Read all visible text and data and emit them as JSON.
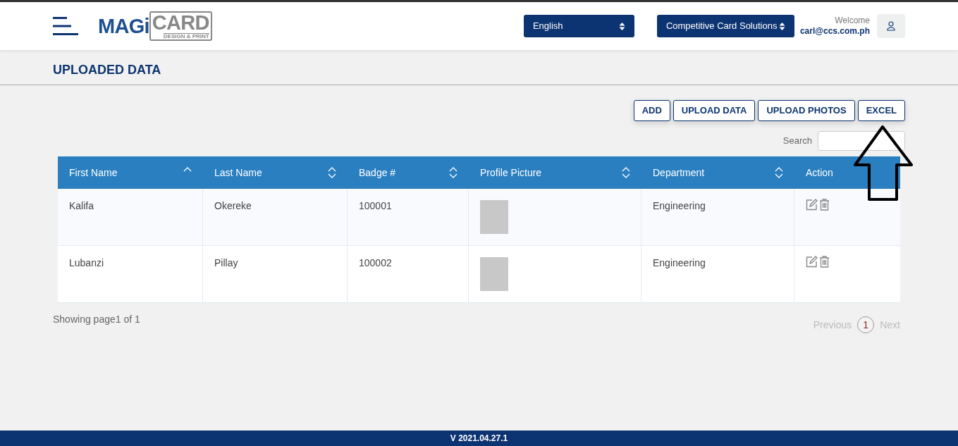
{
  "header": {
    "logo": {
      "brand_left": "MAGi",
      "brand_right": "CARD",
      "tagline": "DESIGN & PRINT"
    },
    "language_select": {
      "value": "English"
    },
    "company_select": {
      "value": "Competitive Card Solutions"
    },
    "welcome": "Welcome",
    "user_email": "carl@ccs.com.ph"
  },
  "page_title": "UPLOADED DATA",
  "actions": [
    "ADD",
    "UPLOAD DATA",
    "UPLOAD PHOTOS",
    "EXCEL"
  ],
  "search": {
    "label": "Search"
  },
  "table": {
    "columns": [
      {
        "label": "First Name",
        "sortable": true,
        "sorted": true
      },
      {
        "label": "Last Name",
        "sortable": true,
        "sorted": false
      },
      {
        "label": "Badge #",
        "sortable": true,
        "sorted": false
      },
      {
        "label": "Profile Picture",
        "sortable": true,
        "sorted": false
      },
      {
        "label": "Department",
        "sortable": true,
        "sorted": false
      },
      {
        "label": "Action",
        "sortable": false,
        "sorted": false
      }
    ],
    "rows": [
      {
        "first_name": "Kalifa",
        "last_name": "Okereke",
        "badge": "100001",
        "department": "Engineering"
      },
      {
        "first_name": "Lubanzi",
        "last_name": "Pillay",
        "badge": "100002",
        "department": "Engineering"
      }
    ]
  },
  "pagination": {
    "summary": "Showing page1 of 1",
    "previous": "Previous",
    "pages": [
      {
        "label": "1",
        "selected": true
      }
    ],
    "next": "Next"
  },
  "annotation": {
    "kind": "up-arrow"
  },
  "footer": {
    "version": "V 2021.04.27.1"
  }
}
